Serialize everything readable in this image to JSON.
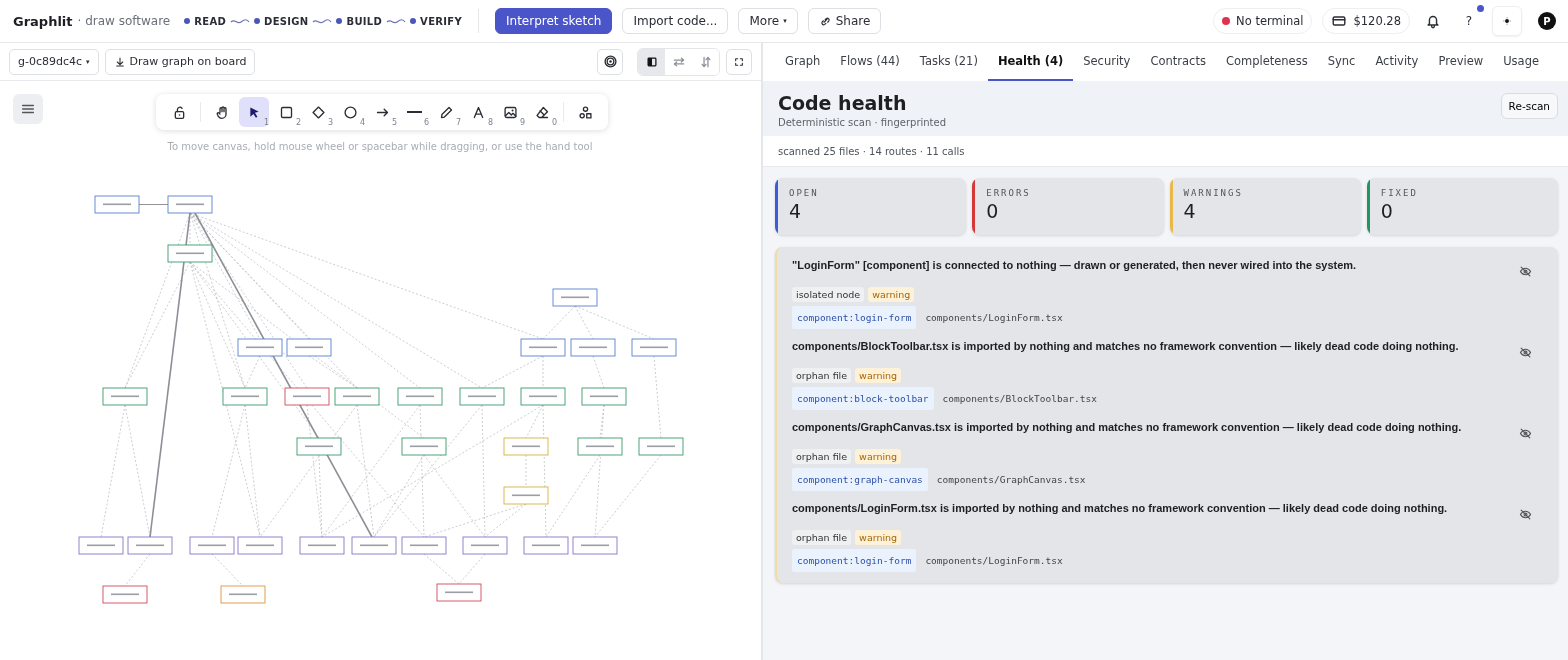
{
  "app": {
    "name": "Graphlit",
    "subtitle": "· draw software"
  },
  "steps": [
    "READ",
    "DESIGN",
    "BUILD",
    "VERIFY"
  ],
  "top_actions": [
    {
      "label": "Interpret sketch",
      "kind": "primary"
    },
    {
      "label": "Import code...",
      "kind": "plain"
    },
    {
      "label": "More",
      "kind": "menu",
      "caret": "▾"
    },
    {
      "label": "Share",
      "kind": "link"
    }
  ],
  "status": {
    "terminal": "No terminal",
    "connected": false,
    "balance": "$120.28",
    "help": "?",
    "help_badge": true,
    "avatar": "P"
  },
  "canvas": {
    "graph_select": "g-0c89dc4c",
    "graph_select_caret": "▾",
    "draw_button": "Draw graph on board",
    "layout_modes": [
      {
        "kind": "split",
        "selected": true
      },
      {
        "kind": "horizontal",
        "selected": false
      },
      {
        "kind": "vertical",
        "selected": false
      }
    ],
    "tools": [
      {
        "kind": "lock",
        "selected": false
      },
      {
        "kind": "hand",
        "selected": false
      },
      {
        "kind": "select",
        "key": "1",
        "selected": true
      },
      {
        "kind": "rect",
        "key": "2",
        "selected": false
      },
      {
        "kind": "diamond",
        "key": "3",
        "selected": false
      },
      {
        "kind": "circle",
        "key": "4",
        "selected": false
      },
      {
        "kind": "arrow",
        "key": "5",
        "selected": false
      },
      {
        "kind": "line",
        "key": "6",
        "selected": false
      },
      {
        "kind": "pencil",
        "key": "7",
        "selected": false
      },
      {
        "kind": "text",
        "key": "8",
        "selected": false
      },
      {
        "kind": "image",
        "key": "9",
        "selected": false
      },
      {
        "kind": "eraser",
        "key": "0",
        "selected": false
      },
      {
        "kind": "shapes",
        "selected": false
      }
    ],
    "hint": "To move canvas, hold mouse wheel or spacebar while dragging, or use the hand tool"
  },
  "tabs": [
    {
      "label": "Graph",
      "selected": false
    },
    {
      "label": "Flows (44)",
      "selected": false
    },
    {
      "label": "Tasks (21)",
      "selected": false
    },
    {
      "label": "Health (4)",
      "selected": true
    },
    {
      "label": "Security",
      "selected": false
    },
    {
      "label": "Contracts",
      "selected": false
    },
    {
      "label": "Completeness",
      "selected": false
    },
    {
      "label": "Sync",
      "selected": false
    },
    {
      "label": "Activity",
      "selected": false
    },
    {
      "label": "Preview",
      "selected": false
    },
    {
      "label": "Usage",
      "selected": false
    }
  ],
  "health": {
    "title": "Code health",
    "subtitle": "Deterministic scan · fingerprinted",
    "rescan": "Re-scan",
    "summary": "scanned 25 files · 14 routes · 11 calls",
    "stats": [
      {
        "label": "OPEN",
        "value": "4",
        "color": "#3b5bdb"
      },
      {
        "label": "ERRORS",
        "value": "0",
        "color": "#d63838"
      },
      {
        "label": "WARNINGS",
        "value": "4",
        "color": "#e8b84a"
      },
      {
        "label": "FIXED",
        "value": "0",
        "color": "#23955f"
      }
    ],
    "issues": [
      {
        "message": "\"LoginForm\" [component] is connected to nothing — drawn or generated, then never wired into the system.",
        "tags": [
          {
            "label": "isolated node",
            "kind": "category"
          },
          {
            "label": "warning",
            "kind": "severity"
          }
        ],
        "id": "component:login-form",
        "path": "components/LoginForm.tsx"
      },
      {
        "message": "components/BlockToolbar.tsx is imported by nothing and matches no framework convention — likely dead code doing nothing.",
        "tags": [
          {
            "label": "orphan file",
            "kind": "category"
          },
          {
            "label": "warning",
            "kind": "severity"
          }
        ],
        "id": "component:block-toolbar",
        "path": "components/BlockToolbar.tsx"
      },
      {
        "message": "components/GraphCanvas.tsx is imported by nothing and matches no framework convention — likely dead code doing nothing.",
        "tags": [
          {
            "label": "orphan file",
            "kind": "category"
          },
          {
            "label": "warning",
            "kind": "severity"
          }
        ],
        "id": "component:graph-canvas",
        "path": "components/GraphCanvas.tsx"
      },
      {
        "message": "components/LoginForm.tsx is imported by nothing and matches no framework convention — likely dead code doing nothing.",
        "tags": [
          {
            "label": "orphan file",
            "kind": "category"
          },
          {
            "label": "warning",
            "kind": "severity"
          }
        ],
        "id": "component:login-form",
        "path": "components/LoginForm.tsx"
      }
    ]
  }
}
